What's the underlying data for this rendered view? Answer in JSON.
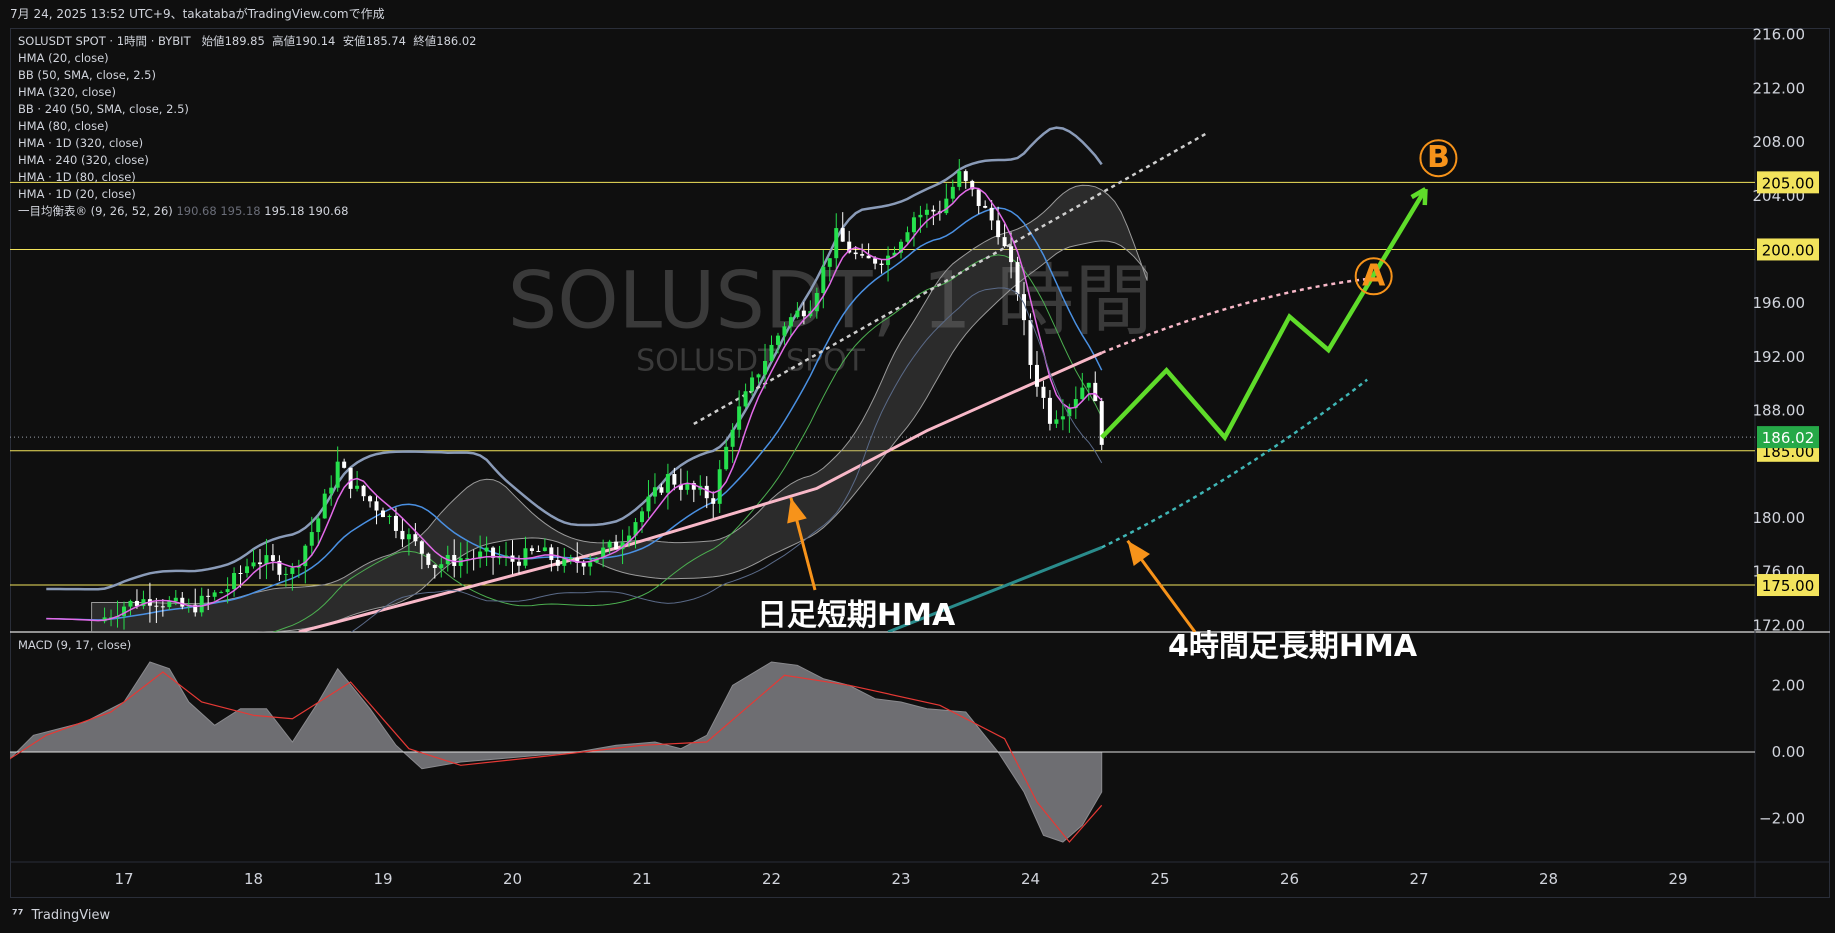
{
  "header": {
    "timestamp_text": "7月 24, 2025 13:52 UTC+9、takatabaがTradingView.comで作成"
  },
  "legend": {
    "title_prefix": "SOLUSDT SPOT · 1時間 · BYBIT",
    "open_label": "始値",
    "open": "189.85",
    "high_label": "高値",
    "high": "190.14",
    "low_label": "安値",
    "low": "185.74",
    "close_label": "終値",
    "close": "186.02",
    "indicators": [
      "HMA (20, close)",
      "BB (50, SMA, close, 2.5)",
      "HMA (320, close)",
      "BB · 240 (50, SMA, close, 2.5)",
      "HMA (80, close)",
      "HMA · 1D (320, close)",
      "HMA · 240 (320, close)",
      "HMA · 1D (80, close)",
      "HMA · 1D (20, close)"
    ],
    "ichimoku_label": "一目均衡表® (9, 26, 52, 26)",
    "ichimoku_values": [
      "190.68",
      "195.18",
      "195.18",
      "190.68"
    ]
  },
  "watermark": {
    "symbol": "SOLUSDT, 1 時間",
    "sub": "SOLUSDT SPOT"
  },
  "annotations": {
    "daily_hma": "日足短期HMA",
    "h4_hma": "4時間足長期HMA",
    "point_a": "A",
    "point_b": "B"
  },
  "macd": {
    "label": "MACD (9, 17, close)"
  },
  "footer": {
    "brand": "TradingView"
  },
  "colors": {
    "background": "#0f0f0f",
    "up_candle": "#26e04d",
    "down_candle": "#ffffff",
    "hma20": "#e26ae8",
    "hma80": "#4a90e2",
    "bb_band": "#8a9bb8",
    "daily_hma": "#f8b8c8",
    "h4_hma": "#2a8c8c",
    "forecast": "#5fdc2a",
    "arrows": "#f7931a",
    "level_line": "#f2e35c",
    "price_badge": "#26a948"
  },
  "chart_data": [
    {
      "type": "candlestick",
      "title": "SOLUSDT SPOT · 1時間 · BYBIT",
      "y_axis_ticks": [
        "216.00",
        "212.00",
        "208.00",
        "204.00",
        "196.00",
        "192.00",
        "188.00",
        "180.00",
        "176.00",
        "172.00"
      ],
      "ylim": [
        171.5,
        216.5
      ],
      "x_axis_ticks": [
        "17",
        "18",
        "19",
        "20",
        "21",
        "22",
        "23",
        "24",
        "25",
        "26",
        "27",
        "28",
        "29"
      ],
      "horizontal_levels": [
        205.0,
        200.0,
        185.0,
        175.0
      ],
      "level_labels": [
        "205.00",
        "200.00",
        "185.00",
        "175.00"
      ],
      "current_price": 186.02,
      "current_price_label": "186.02",
      "close_path": [
        {
          "x": 16.4,
          "y": 172.5
        },
        {
          "x": 16.8,
          "y": 172.3
        },
        {
          "x": 17.0,
          "y": 173.5
        },
        {
          "x": 17.2,
          "y": 174.0
        },
        {
          "x": 17.5,
          "y": 173.2
        },
        {
          "x": 17.8,
          "y": 174.8
        },
        {
          "x": 18.0,
          "y": 177.0
        },
        {
          "x": 18.3,
          "y": 176.0
        },
        {
          "x": 18.5,
          "y": 180.0
        },
        {
          "x": 18.65,
          "y": 184.0
        },
        {
          "x": 18.8,
          "y": 182.0
        },
        {
          "x": 19.0,
          "y": 180.5
        },
        {
          "x": 19.2,
          "y": 178.5
        },
        {
          "x": 19.4,
          "y": 176.5
        },
        {
          "x": 19.6,
          "y": 177.0
        },
        {
          "x": 19.8,
          "y": 177.2
        },
        {
          "x": 20.0,
          "y": 176.8
        },
        {
          "x": 20.2,
          "y": 177.5
        },
        {
          "x": 20.4,
          "y": 176.5
        },
        {
          "x": 20.6,
          "y": 177.0
        },
        {
          "x": 20.8,
          "y": 178.0
        },
        {
          "x": 21.0,
          "y": 180.5
        },
        {
          "x": 21.2,
          "y": 183.0
        },
        {
          "x": 21.4,
          "y": 182.0
        },
        {
          "x": 21.55,
          "y": 181.5
        },
        {
          "x": 21.7,
          "y": 187.0
        },
        {
          "x": 21.9,
          "y": 191.0
        },
        {
          "x": 22.1,
          "y": 194.5
        },
        {
          "x": 22.3,
          "y": 196.0
        },
        {
          "x": 22.5,
          "y": 201.0
        },
        {
          "x": 22.7,
          "y": 199.0
        },
        {
          "x": 22.9,
          "y": 199.5
        },
        {
          "x": 23.1,
          "y": 202.5
        },
        {
          "x": 23.3,
          "y": 203.0
        },
        {
          "x": 23.45,
          "y": 205.5
        },
        {
          "x": 23.6,
          "y": 203.5
        },
        {
          "x": 23.75,
          "y": 201.5
        },
        {
          "x": 23.9,
          "y": 197.0
        },
        {
          "x": 24.0,
          "y": 191.5
        },
        {
          "x": 24.15,
          "y": 187.5
        },
        {
          "x": 24.3,
          "y": 188.5
        },
        {
          "x": 24.45,
          "y": 190.5
        },
        {
          "x": 24.55,
          "y": 186.02
        }
      ],
      "forecast_path": [
        {
          "x": 24.55,
          "y": 186.0
        },
        {
          "x": 25.05,
          "y": 191.0
        },
        {
          "x": 25.5,
          "y": 186.0
        },
        {
          "x": 26.0,
          "y": 195.0
        },
        {
          "x": 26.3,
          "y": 192.5
        },
        {
          "x": 27.05,
          "y": 204.5
        }
      ]
    },
    {
      "type": "area",
      "title": "MACD (9, 17, close)",
      "y_axis_ticks": [
        "2.00",
        "0.00",
        "−2.00"
      ],
      "ylim": [
        -3.3,
        3.6
      ],
      "histogram_path": [
        {
          "x": 16.0,
          "y": -0.2
        },
        {
          "x": 16.3,
          "y": 0.5
        },
        {
          "x": 16.7,
          "y": 0.9
        },
        {
          "x": 17.0,
          "y": 1.5
        },
        {
          "x": 17.2,
          "y": 2.7
        },
        {
          "x": 17.35,
          "y": 2.5
        },
        {
          "x": 17.5,
          "y": 1.5
        },
        {
          "x": 17.7,
          "y": 0.8
        },
        {
          "x": 17.9,
          "y": 1.3
        },
        {
          "x": 18.1,
          "y": 1.3
        },
        {
          "x": 18.3,
          "y": 0.3
        },
        {
          "x": 18.5,
          "y": 1.5
        },
        {
          "x": 18.65,
          "y": 2.5
        },
        {
          "x": 18.9,
          "y": 1.3
        },
        {
          "x": 19.1,
          "y": 0.2
        },
        {
          "x": 19.3,
          "y": -0.5
        },
        {
          "x": 19.6,
          "y": -0.3
        },
        {
          "x": 19.9,
          "y": -0.2
        },
        {
          "x": 20.2,
          "y": -0.1
        },
        {
          "x": 20.5,
          "y": 0.0
        },
        {
          "x": 20.8,
          "y": 0.2
        },
        {
          "x": 21.1,
          "y": 0.3
        },
        {
          "x": 21.3,
          "y": 0.1
        },
        {
          "x": 21.5,
          "y": 0.5
        },
        {
          "x": 21.7,
          "y": 2.0
        },
        {
          "x": 22.0,
          "y": 2.7
        },
        {
          "x": 22.2,
          "y": 2.6
        },
        {
          "x": 22.4,
          "y": 2.2
        },
        {
          "x": 22.6,
          "y": 2.0
        },
        {
          "x": 22.8,
          "y": 1.6
        },
        {
          "x": 23.0,
          "y": 1.5
        },
        {
          "x": 23.2,
          "y": 1.3
        },
        {
          "x": 23.5,
          "y": 1.2
        },
        {
          "x": 23.75,
          "y": 0.0
        },
        {
          "x": 23.95,
          "y": -1.2
        },
        {
          "x": 24.1,
          "y": -2.5
        },
        {
          "x": 24.25,
          "y": -2.7
        },
        {
          "x": 24.4,
          "y": -2.2
        },
        {
          "x": 24.55,
          "y": -1.2
        }
      ],
      "signal_path": [
        {
          "x": 16.0,
          "y": -0.5
        },
        {
          "x": 16.4,
          "y": 0.5
        },
        {
          "x": 16.9,
          "y": 1.2
        },
        {
          "x": 17.3,
          "y": 2.4
        },
        {
          "x": 17.6,
          "y": 1.5
        },
        {
          "x": 18.0,
          "y": 1.1
        },
        {
          "x": 18.3,
          "y": 1.0
        },
        {
          "x": 18.75,
          "y": 2.1
        },
        {
          "x": 19.2,
          "y": 0.1
        },
        {
          "x": 19.6,
          "y": -0.4
        },
        {
          "x": 20.2,
          "y": -0.15
        },
        {
          "x": 21.0,
          "y": 0.2
        },
        {
          "x": 21.5,
          "y": 0.3
        },
        {
          "x": 22.1,
          "y": 2.3
        },
        {
          "x": 22.6,
          "y": 2.0
        },
        {
          "x": 23.3,
          "y": 1.4
        },
        {
          "x": 23.8,
          "y": 0.4
        },
        {
          "x": 24.05,
          "y": -1.5
        },
        {
          "x": 24.3,
          "y": -2.7
        },
        {
          "x": 24.55,
          "y": -1.6
        }
      ]
    }
  ]
}
